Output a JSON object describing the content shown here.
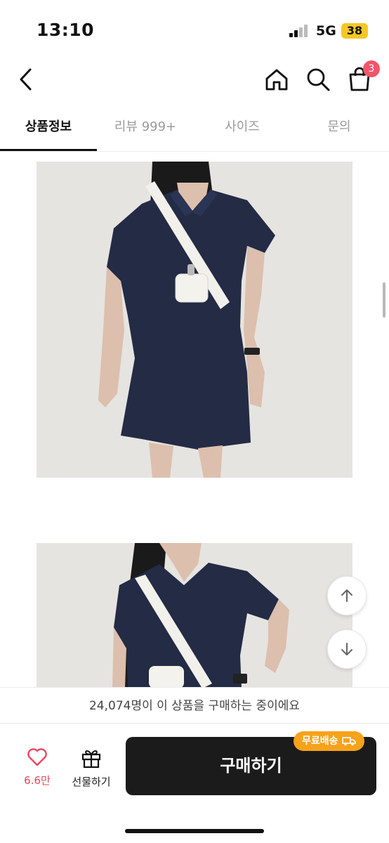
{
  "status_bar": {
    "time": "13:10",
    "network": "5G",
    "battery": "38"
  },
  "nav": {
    "cart_count": "3",
    "icons": [
      "back-icon",
      "home-icon",
      "search-icon",
      "cart-icon"
    ]
  },
  "tabs": [
    {
      "label": "상품정보"
    },
    {
      "label": "리뷰 999+"
    },
    {
      "label": "사이즈"
    },
    {
      "label": "문의"
    }
  ],
  "banner": {
    "text": "24,074명이 이 상품을 구매하는 중이에요"
  },
  "bottom": {
    "like_count": "6.6만",
    "gift_label": "선물하기",
    "buy_label": "구매하기",
    "free_shipping": "무료배송"
  },
  "colors": {
    "accent": "#f0566a",
    "like": "#e8475f",
    "free_shipping": "#f7a21b",
    "buy_button": "#1b1b1b",
    "battery": "#f6c724",
    "dress": "#232b45"
  }
}
